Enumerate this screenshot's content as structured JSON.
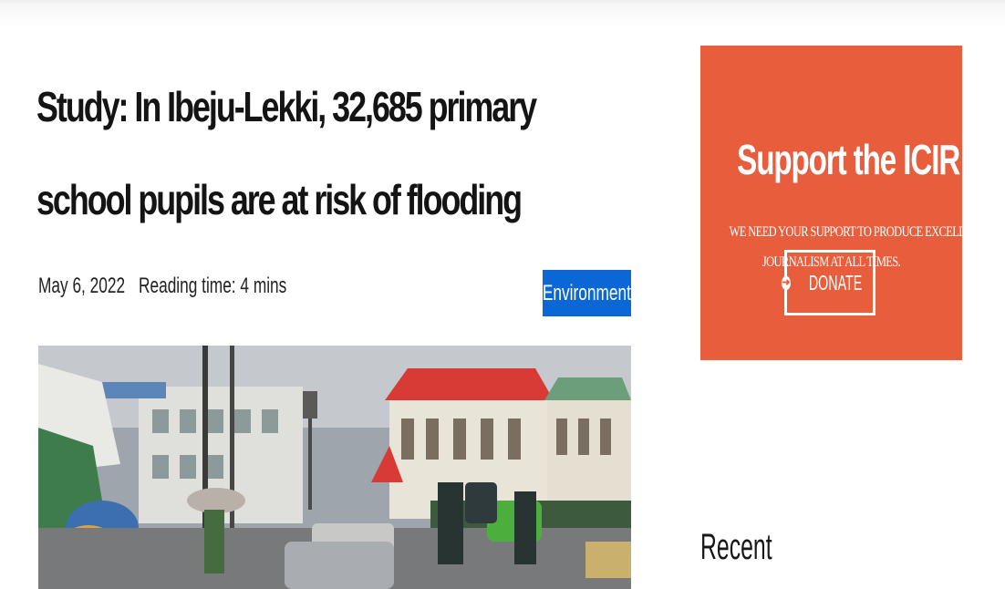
{
  "article": {
    "title": "Study: In Ibeju-Lekki, 32,685 primary school pupils are at risk of flooding",
    "date": "May 6, 2022",
    "reading_time": "Reading time: 4 mins",
    "category": "Environment"
  },
  "sidebar": {
    "support": {
      "title": "Support the ICIR",
      "text_line1": "WE NEED YOUR SUPPORT TO PRODUCE EXCELLENT",
      "text_line2": "JOURNALISM AT ALL TIMES.",
      "donate_label": "DONATE",
      "donate_icon": "arrow-right-circle-icon",
      "background_color": "#e85d3c"
    },
    "recent_heading": "Recent"
  },
  "colors": {
    "category_badge": "#0b67d6",
    "title_text": "#141414"
  }
}
